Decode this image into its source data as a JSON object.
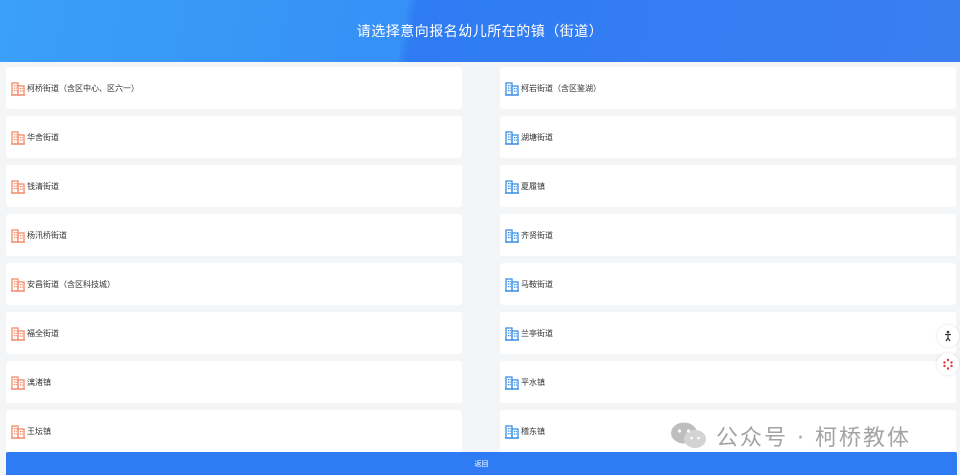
{
  "header": {
    "title": "请选择意向报名幼儿所在的镇（街道）"
  },
  "colors": {
    "left_icon": "#f08a6a",
    "right_icon": "#3a8ee6"
  },
  "towns_left": [
    "柯桥街道（含区中心、区六一）",
    "华舍街道",
    "钱清街道",
    "杨汛桥街道",
    "安昌街道（含区科技城）",
    "福全街道",
    "漓渚镇",
    "王坛镇"
  ],
  "towns_right": [
    "柯岩街道（含区鉴湖）",
    "湖塘街道",
    "夏履镇",
    "齐贤街道",
    "马鞍街道",
    "兰亭街道",
    "平水镇",
    "稽东镇"
  ],
  "footer": {
    "back_label": "返回"
  },
  "watermark": {
    "text": "公众号 · 柯桥教体"
  }
}
